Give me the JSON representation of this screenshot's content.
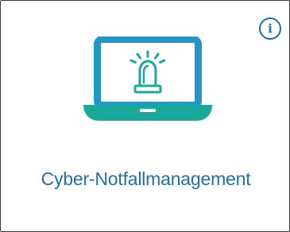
{
  "tile": {
    "title": "Cyber-Notfallmanagement",
    "illustration_icon": "laptop-alarm-siren-icon",
    "info_glyph": "i",
    "info_icon": "info-icon"
  },
  "colors": {
    "title_text": "#1f6fa8",
    "laptop_frame": "#2196c9",
    "laptop_base": "#1aa89a",
    "siren": "#1aa89a",
    "info_accent": "#1f6fa8"
  }
}
